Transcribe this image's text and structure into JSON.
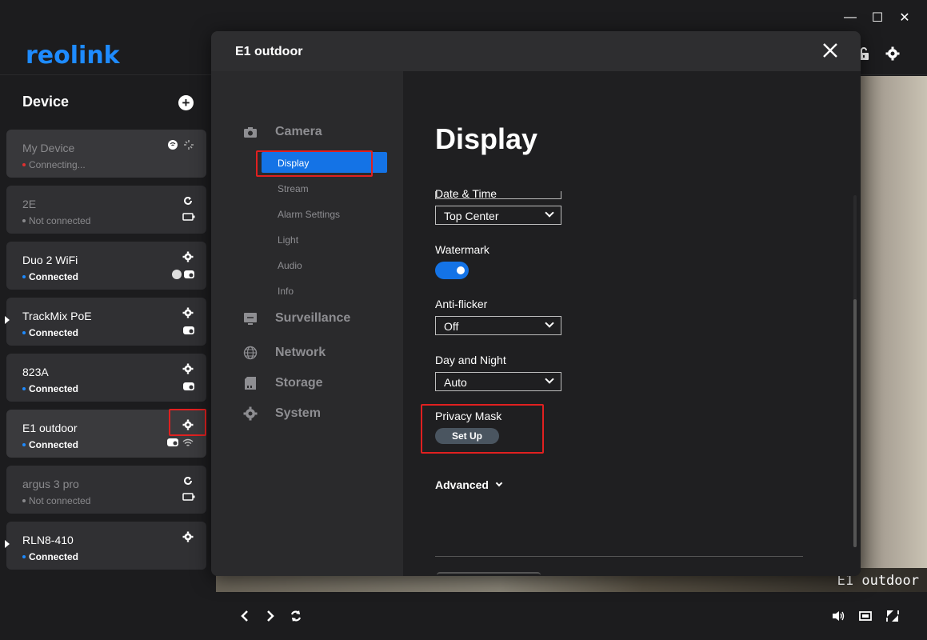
{
  "app": {
    "logo": "reolink"
  },
  "window": {
    "minimize": "—",
    "maximize": "☐",
    "close": "✕"
  },
  "sidebar": {
    "title": "Device",
    "devices": [
      {
        "name": "My Device",
        "status": "Connecting...",
        "state": "connecting"
      },
      {
        "name": "2E",
        "status": "Not connected",
        "state": "offline"
      },
      {
        "name": "Duo 2 WiFi",
        "status": "Connected",
        "state": "connected"
      },
      {
        "name": "TrackMix PoE",
        "status": "Connected",
        "state": "connected"
      },
      {
        "name": "823A",
        "status": "Connected",
        "state": "connected"
      },
      {
        "name": "E1 outdoor",
        "status": "Connected",
        "state": "connected"
      },
      {
        "name": "argus 3 pro",
        "status": "Not connected",
        "state": "offline"
      },
      {
        "name": "RLN8-410",
        "status": "Connected",
        "state": "connected"
      }
    ]
  },
  "live": {
    "osd": "E1 outdoor"
  },
  "modal": {
    "title": "E1 outdoor",
    "nav": {
      "camera": "Camera",
      "display": "Display",
      "stream": "Stream",
      "alarm": "Alarm Settings",
      "light": "Light",
      "audio": "Audio",
      "info": "Info",
      "surveillance": "Surveillance",
      "network": "Network",
      "storage": "Storage",
      "system": "System"
    },
    "content": {
      "title": "Display",
      "datetime_label": "Date & Time",
      "datetime_value": "Top Center",
      "watermark_label": "Watermark",
      "watermark_on": true,
      "antiflicker_label": "Anti-flicker",
      "antiflicker_value": "Off",
      "daynight_label": "Day and Night",
      "daynight_value": "Auto",
      "privacy_label": "Privacy Mask",
      "setup_button": "Set Up",
      "advanced": "Advanced"
    }
  },
  "colors": {
    "accent": "#1473e6",
    "highlight": "#e02020"
  }
}
